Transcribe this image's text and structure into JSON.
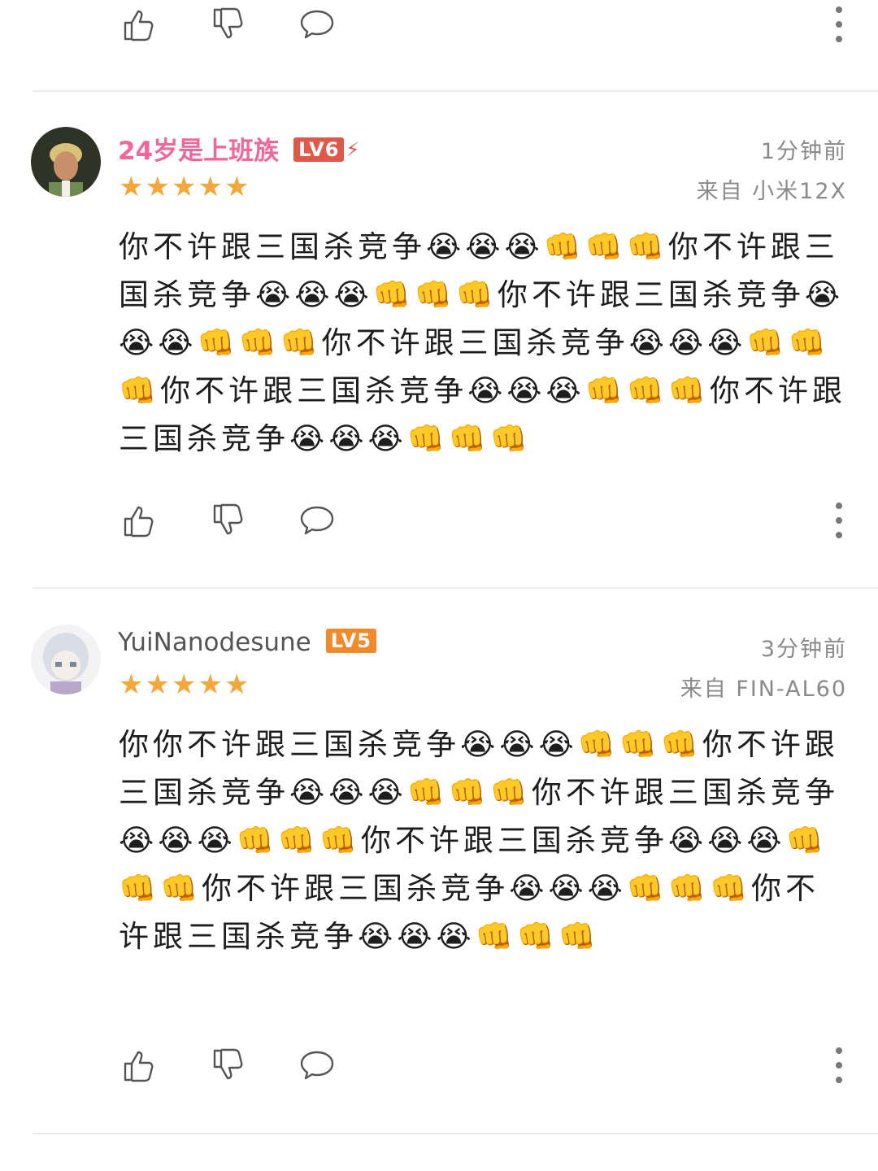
{
  "colors": {
    "username_pink": "#f0679a",
    "lv6_badge": "#e0584a",
    "lv5_badge": "#f08a2a",
    "star": "#f4a73a",
    "meta_gray": "#8a8a8a"
  },
  "icons": {
    "like": "thumbs-up-icon",
    "dislike": "thumbs-down-icon",
    "reply": "comment-bubble-icon",
    "more": "more-vertical-icon"
  },
  "comments": [
    {
      "username": "24岁是上班族",
      "level": "LV6",
      "rating": 5,
      "time": "1分钟前",
      "device": "来自 小米12X",
      "text": "你不许跟三国杀竞争😭😭😭👊👊👊你不许跟三国杀竞争😭😭😭👊👊👊你不许跟三国杀竞争😭😭😭👊👊👊你不许跟三国杀竞争😭😭😭👊👊👊你不许跟三国杀竞争😭😭😭👊👊👊你不许跟三国杀竞争😭😭😭👊👊👊"
    },
    {
      "username": "YuiNanodesune",
      "level": "LV5",
      "rating": 5,
      "time": "3分钟前",
      "device": "来自 FIN-AL60",
      "text": "你你不许跟三国杀竞争😭😭😭👊👊👊你不许跟三国杀竞争😭😭😭👊👊👊你不许跟三国杀竞争😭😭😭👊👊👊你不许跟三国杀竞争😭😭😭👊👊👊你不许跟三国杀竞争😭😭😭👊👊👊你不许跟三国杀竞争😭😭😭👊👊👊"
    }
  ]
}
